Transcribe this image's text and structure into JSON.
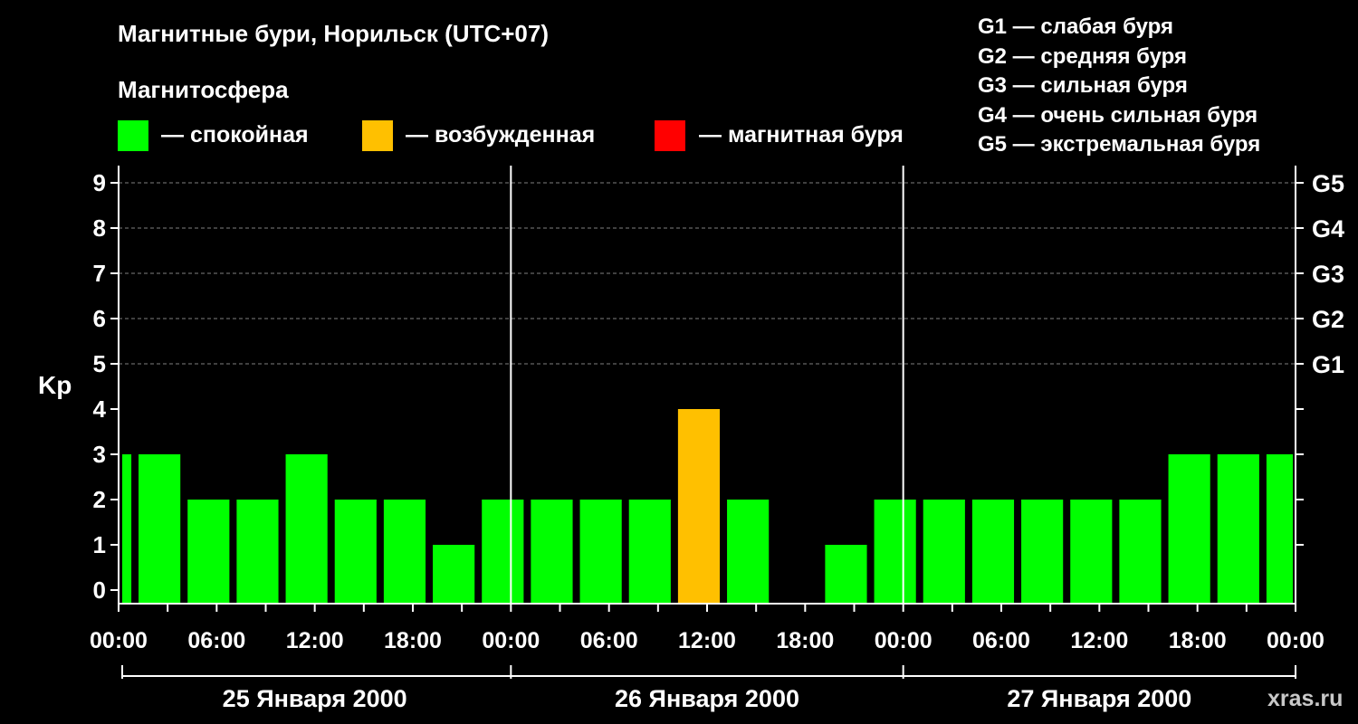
{
  "title": "Магнитные бури, Норильск (UTC+07)",
  "subtitle": "Магнитосфера",
  "legend": [
    {
      "color": "#00ff00",
      "label": "— спокойная"
    },
    {
      "color": "#ffc000",
      "label": "— возбужденная"
    },
    {
      "color": "#ff0000",
      "label": "— магнитная буря"
    }
  ],
  "g_scale": [
    "G1 — слабая буря",
    "G2 — средняя буря",
    "G3 — сильная буря",
    "G4 — очень сильная буря",
    "G5 — экстремальная буря"
  ],
  "watermark": "xras.ru",
  "chart_data": {
    "type": "bar",
    "ylabel": "Kp",
    "ylim": [
      0,
      9
    ],
    "y_ticks": [
      "0",
      "1",
      "2",
      "3",
      "4",
      "5",
      "6",
      "7",
      "8",
      "9"
    ],
    "right_ticks": [
      {
        "value": 5,
        "label": "G1"
      },
      {
        "value": 6,
        "label": "G2"
      },
      {
        "value": 7,
        "label": "G3"
      },
      {
        "value": 8,
        "label": "G4"
      },
      {
        "value": 9,
        "label": "G5"
      }
    ],
    "grid": "dashed at Kp 5–9",
    "x_tick_labels": [
      "00:00",
      "06:00",
      "12:00",
      "18:00",
      "00:00",
      "06:00",
      "12:00",
      "18:00",
      "00:00",
      "06:00",
      "12:00",
      "18:00",
      "00:00"
    ],
    "days": [
      "25 Января 2000",
      "26 Января 2000",
      "27 Января 2000"
    ],
    "values": [
      3,
      3,
      2,
      2,
      3,
      2,
      2,
      1,
      2,
      2,
      2,
      2,
      4,
      2,
      0,
      1,
      2,
      2,
      2,
      2,
      2,
      2,
      3,
      3,
      3
    ],
    "colors": {
      "quiet": "#00ff00",
      "active": "#ffc000",
      "storm": "#ff0000"
    }
  }
}
